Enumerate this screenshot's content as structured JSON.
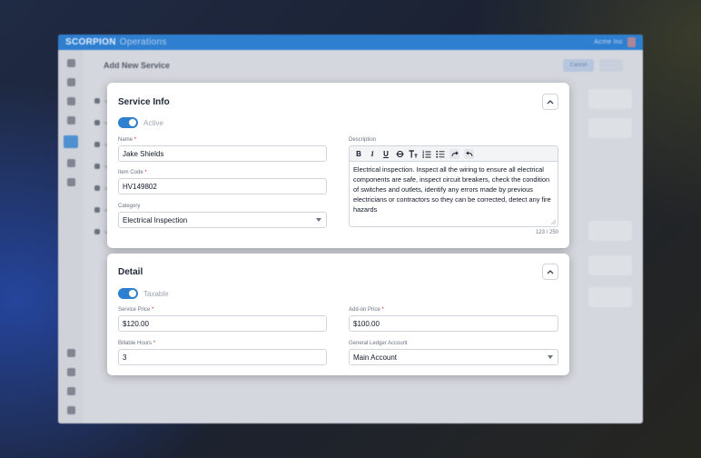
{
  "background_app": {
    "brand": "SCORPION",
    "brand_sub": "Operations",
    "user_label": "Acme Inc",
    "page_title": "Add New Service",
    "cancel_label": "Cancel"
  },
  "service_info": {
    "title": "Service Info",
    "active_label": "Active",
    "active_on": true,
    "name_label": "Name",
    "name_value": "Jake Shields",
    "item_code_label": "Item Code",
    "item_code_value": "HV149802",
    "category_label": "Category",
    "category_value": "Electrical Inspection",
    "description_label": "Description",
    "description_value": "Electrical inspection.  Inspect all the wiring to ensure all electrical components are safe, inspect circuit breakers, check the condition of switches and outlets, identify any errors made by previous electricians or contractors so they can be corrected, detect any fire hazards",
    "char_count": "123 / 250",
    "toolbar": [
      "bold-icon",
      "italic-icon",
      "underline-icon",
      "strikethrough-icon",
      "text-size-icon",
      "ordered-list-icon",
      "bullet-list-icon",
      "redo-icon",
      "undo-icon"
    ]
  },
  "detail": {
    "title": "Detail",
    "taxable_label": "Taxable",
    "taxable_on": true,
    "service_price_label": "Service Price",
    "service_price_value": "$120.00",
    "addon_price_label": "Add-on Price",
    "addon_price_value": "$100.00",
    "billable_hours_label": "Billable Hours",
    "billable_hours_value": "3",
    "gl_account_label": "General Ledger Account",
    "gl_account_value": "Main Account"
  },
  "colors": {
    "accent": "#2f7fd0",
    "required": "#dc2626"
  }
}
